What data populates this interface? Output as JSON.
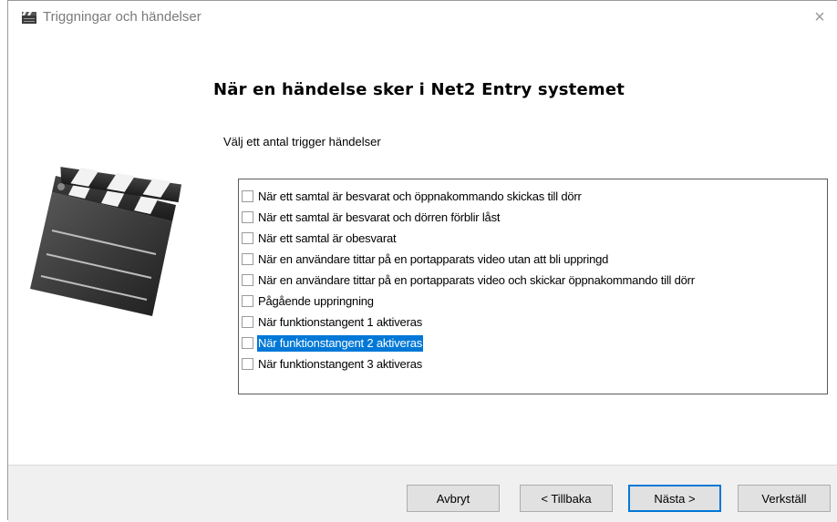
{
  "window": {
    "title": "Triggningar och händelser",
    "close_glyph": "×"
  },
  "heading": "När en händelse sker i Net2 Entry systemet",
  "subheading": "Välj ett antal trigger händelser",
  "icons": {
    "title": "clapperboard-icon",
    "illustration": "clapperboard-icon",
    "close": "close-icon"
  },
  "trigger_list": {
    "items": [
      {
        "label": "När ett samtal är besvarat och öppnakommando skickas till dörr",
        "checked": false,
        "selected": false
      },
      {
        "label": "När ett samtal är besvarat och dörren förblir låst",
        "checked": false,
        "selected": false
      },
      {
        "label": "När ett samtal är obesvarat",
        "checked": false,
        "selected": false
      },
      {
        "label": "När en användare tittar på en portapparats video utan att bli uppringd",
        "checked": false,
        "selected": false
      },
      {
        "label": "När en användare tittar på en portapparats video och skickar öppnakommando till dörr",
        "checked": false,
        "selected": false
      },
      {
        "label": "Pågående uppringning",
        "checked": false,
        "selected": false
      },
      {
        "label": "När funktionstangent 1 aktiveras",
        "checked": false,
        "selected": false
      },
      {
        "label": "När funktionstangent 2 aktiveras",
        "checked": false,
        "selected": true
      },
      {
        "label": "När funktionstangent 3 aktiveras",
        "checked": false,
        "selected": false
      }
    ]
  },
  "buttons": {
    "cancel": "Avbryt",
    "back": "< Tillbaka",
    "next": "Nästa >",
    "apply": "Verkställ"
  },
  "colors": {
    "selection": "#0078d7",
    "footer_bg": "#f0f0f0",
    "button_bg": "#e1e1e1"
  }
}
